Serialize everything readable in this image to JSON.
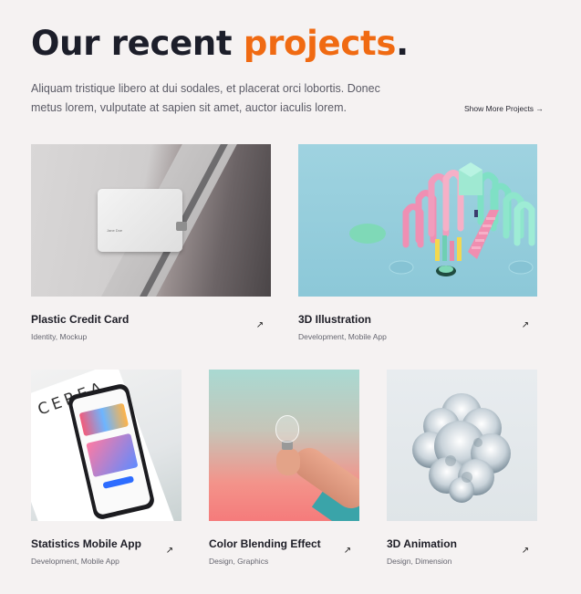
{
  "header": {
    "title_prefix": "Our recent ",
    "title_accent": "projects",
    "title_suffix": ".",
    "description": "Aliquam tristique libero at dui sodales, et placerat orci lobortis. Donec metus lorem, vulputate at sapien sit amet, auctor iaculis lorem.",
    "show_more_label": "Show More Projects →"
  },
  "colors": {
    "accent": "#f06a12",
    "background": "#f5f2f2",
    "text": "#1c1e2a"
  },
  "projects": [
    {
      "title": "Plastic Credit Card",
      "tags": "Identity, Mockup",
      "card_text": "Jane Doe"
    },
    {
      "title": "3D Illustration",
      "tags": "Development, Mobile App"
    },
    {
      "title": "Statistics Mobile App",
      "tags": "Development, Mobile App",
      "paper_text": "CEREA"
    },
    {
      "title": "Color Blending Effect",
      "tags": "Design, Graphics"
    },
    {
      "title": "3D Animation",
      "tags": "Design, Dimension"
    }
  ],
  "icons": {
    "arrow": "arrow-up-right-icon",
    "apple": "apple-logo-icon"
  }
}
